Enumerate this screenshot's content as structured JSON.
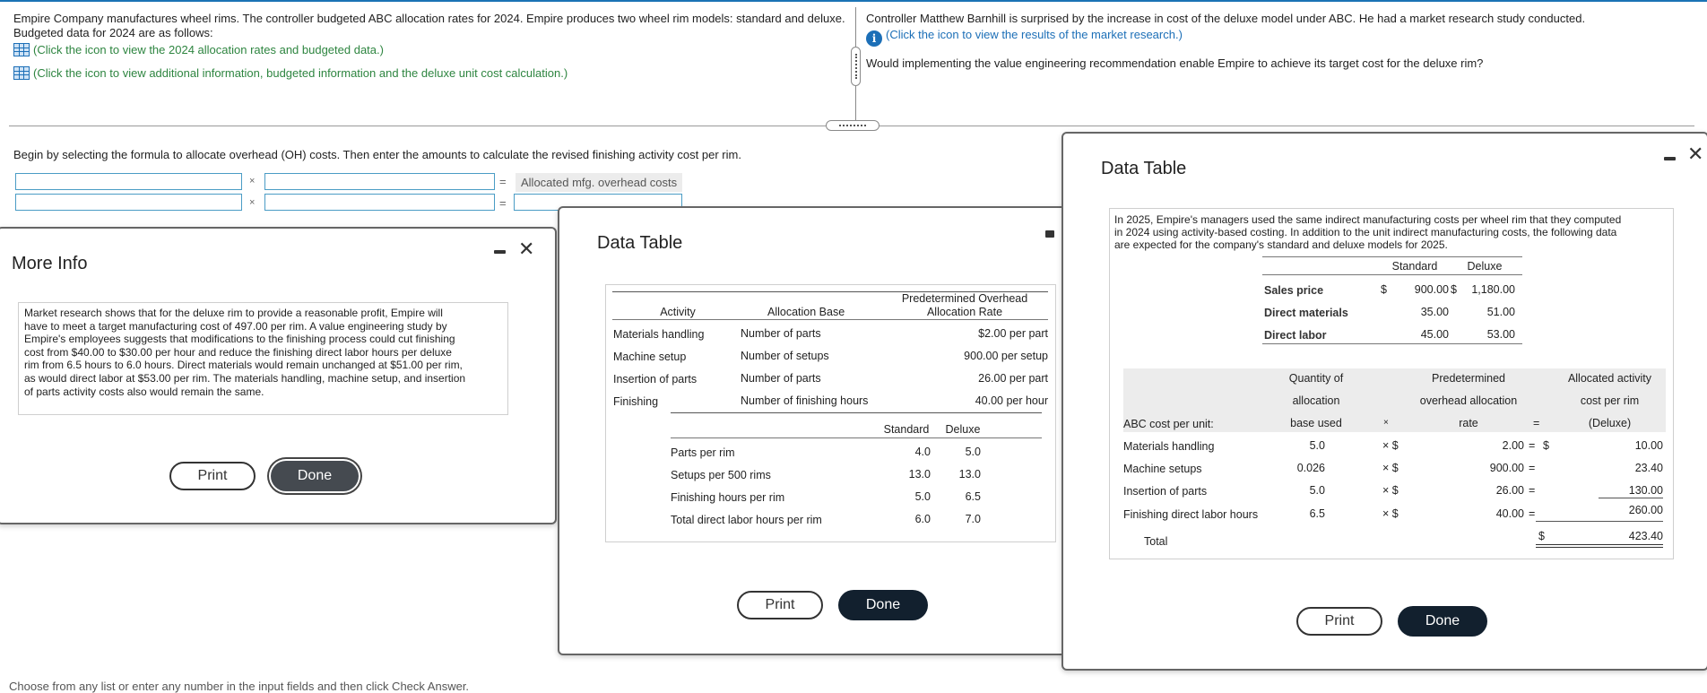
{
  "problem": {
    "intro_line1": "Empire Company manufactures wheel rims. The controller budgeted ABC allocation rates for 2024. Empire produces two wheel rim models: standard and deluxe.",
    "intro_line2": "Budgeted data for 2024 are as follows:",
    "link1": "(Click the icon to view the 2024 allocation rates and budgeted data.)",
    "link2": "(Click the icon to view additional information, budgeted information and the deluxe unit cost calculation.)",
    "right_line1": "Controller Matthew Barnhill is surprised by the increase in cost of the deluxe model under ABC. He had a market research study conducted.",
    "right_link": "(Click the icon to view the results of the market research.)",
    "right_question": "Would implementing the value engineering recommendation enable Empire to achieve its target cost for the deluxe rim?",
    "instruction": "Begin by selecting the formula to allocate overhead (OH) costs. Then enter the amounts to calculate the revised finishing activity cost per rim.",
    "times": "×",
    "equals": "=",
    "alloc_label": "Allocated mfg. overhead costs",
    "footer": "Choose from any list or enter any number in the input fields and then click Check Answer."
  },
  "more_info": {
    "title": "More Info",
    "lines": [
      "Market research shows that for the deluxe rim to provide a reasonable profit, Empire will",
      "have to meet a target manufacturing cost of 497.00 per rim. A value engineering study by",
      "Empire's employees suggests that modifications to the finishing process could cut finishing",
      "cost from $40.00 to $30.00 per hour and reduce the finishing direct labor hours per deluxe",
      "rim from 6.5 hours to 6.0 hours. Direct materials would remain unchanged at $51.00 per rim,",
      "as would direct labor at $53.00 per rim. The materials handling, machine setup, and insertion",
      "of parts activity costs also would remain the same."
    ],
    "print": "Print",
    "done": "Done"
  },
  "data_table_1": {
    "title": "Data Table",
    "headers": {
      "activity": "Activity",
      "base": "Allocation Base",
      "rate_line1": "Predetermined Overhead",
      "rate_line2": "Allocation Rate"
    },
    "rows": [
      {
        "activity": "Materials handling",
        "base": "Number of parts",
        "rate": "$2.00 per part"
      },
      {
        "activity": "Machine setup",
        "base": "Number of setups",
        "rate": "900.00 per setup"
      },
      {
        "activity": "Insertion of parts",
        "base": "Number of parts",
        "rate": "26.00 per part"
      },
      {
        "activity": "Finishing",
        "base": "Number of finishing hours",
        "rate": "40.00 per hour"
      }
    ],
    "col_standard": "Standard",
    "col_deluxe": "Deluxe",
    "rows2": [
      {
        "label": "Parts per rim",
        "standard": "4.0",
        "deluxe": "5.0"
      },
      {
        "label": "Setups per 500 rims",
        "standard": "13.0",
        "deluxe": "13.0"
      },
      {
        "label": "Finishing hours per rim",
        "standard": "5.0",
        "deluxe": "6.5"
      },
      {
        "label": "Total direct labor hours per rim",
        "standard": "6.0",
        "deluxe": "7.0"
      }
    ],
    "print": "Print",
    "done": "Done"
  },
  "data_table_2": {
    "title": "Data Table",
    "intro_lines": [
      "In 2025, Empire's managers used the same indirect manufacturing costs per wheel rim that they computed",
      "in 2024 using activity-based costing. In addition to the unit indirect manufacturing costs, the following data",
      "are expected for the company's standard and deluxe models for 2025."
    ],
    "col_standard": "Standard",
    "col_deluxe": "Deluxe",
    "dollar": "$",
    "top_rows": [
      {
        "label": "Sales price",
        "standard": "900.00",
        "deluxe": "1,180.00"
      },
      {
        "label": "Direct materials",
        "standard": "35.00",
        "deluxe": "51.00"
      },
      {
        "label": "Direct labor",
        "standard": "45.00",
        "deluxe": "53.00"
      }
    ],
    "h_qty": [
      "Quantity of",
      "allocation",
      "base used"
    ],
    "h_rate": [
      "Predetermined",
      "overhead allocation",
      "rate"
    ],
    "h_alloc": [
      "Allocated activity",
      "cost per rim",
      "(Deluxe)"
    ],
    "h_times": "×",
    "h_eq": "=",
    "abc_label": "ABC cost per unit:",
    "abc_rows": [
      {
        "label": "Materials handling",
        "qty": "5.0",
        "rate": "2.00",
        "cost": "10.00",
        "eq": "=",
        "cur": "$"
      },
      {
        "label": "Machine setups",
        "qty": "0.026",
        "rate": "900.00",
        "cost": "23.40",
        "eq": "=",
        "cur": ""
      },
      {
        "label": "Insertion of parts",
        "qty": "5.0",
        "rate": "26.00",
        "cost": "130.00",
        "eq": "=",
        "cur": ""
      },
      {
        "label": "Finishing direct labor hours",
        "qty": "6.5",
        "rate": "40.00",
        "cost": "260.00",
        "eq": "=",
        "cur": ""
      }
    ],
    "times_dollar": "× $",
    "total_label": "Total",
    "total_cur": "$",
    "total_value": "423.40",
    "print": "Print",
    "done": "Done"
  }
}
